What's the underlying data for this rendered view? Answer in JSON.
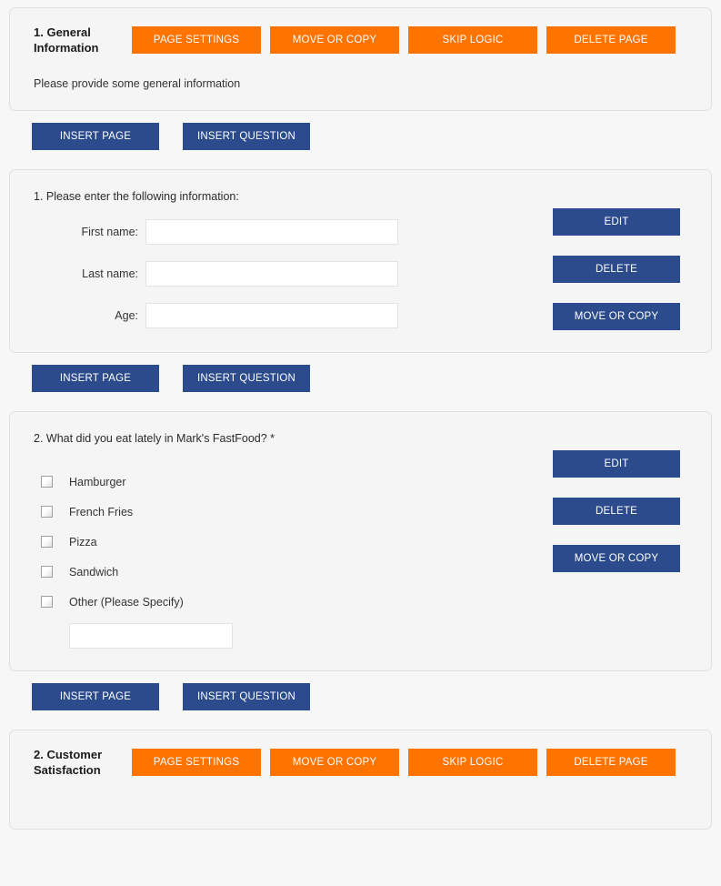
{
  "page_actions": {
    "page_settings": "PAGE SETTINGS",
    "move_or_copy": "MOVE OR COPY",
    "skip_logic": "SKIP LOGIC",
    "delete_page": "DELETE PAGE"
  },
  "insert": {
    "insert_page": "INSERT PAGE",
    "insert_question": "INSERT QUESTION"
  },
  "question_actions": {
    "edit": "EDIT",
    "delete": "DELETE",
    "move_or_copy": "MOVE OR COPY"
  },
  "pages": [
    {
      "title": "1. General Information",
      "description": "Please provide some general information"
    },
    {
      "title": "2. Customer Satisfaction",
      "description": ""
    }
  ],
  "questions": [
    {
      "title": "1. Please enter the following information:",
      "type": "text-fields",
      "fields": [
        {
          "label": "First name:",
          "value": "",
          "placeholder": ""
        },
        {
          "label": "Last name:",
          "value": "",
          "placeholder": ""
        },
        {
          "label": "Age:",
          "value": "",
          "placeholder": ""
        }
      ]
    },
    {
      "title": "2. What did you eat lately in Mark's FastFood? *",
      "type": "checkbox",
      "required_marker": "*",
      "options": [
        {
          "label": "Hamburger",
          "checked": false
        },
        {
          "label": "French Fries",
          "checked": false
        },
        {
          "label": "Pizza",
          "checked": false
        },
        {
          "label": "Sandwich",
          "checked": false
        },
        {
          "label": "Other (Please Specify)",
          "checked": false
        }
      ],
      "other_value": "",
      "other_placeholder": ""
    }
  ],
  "colors": {
    "orange": "#ff7300",
    "blue": "#2b4b8c",
    "panel_bg": "#f5f5f5",
    "panel_border": "#e0e0e0",
    "page_bg": "#f7f7f7"
  }
}
